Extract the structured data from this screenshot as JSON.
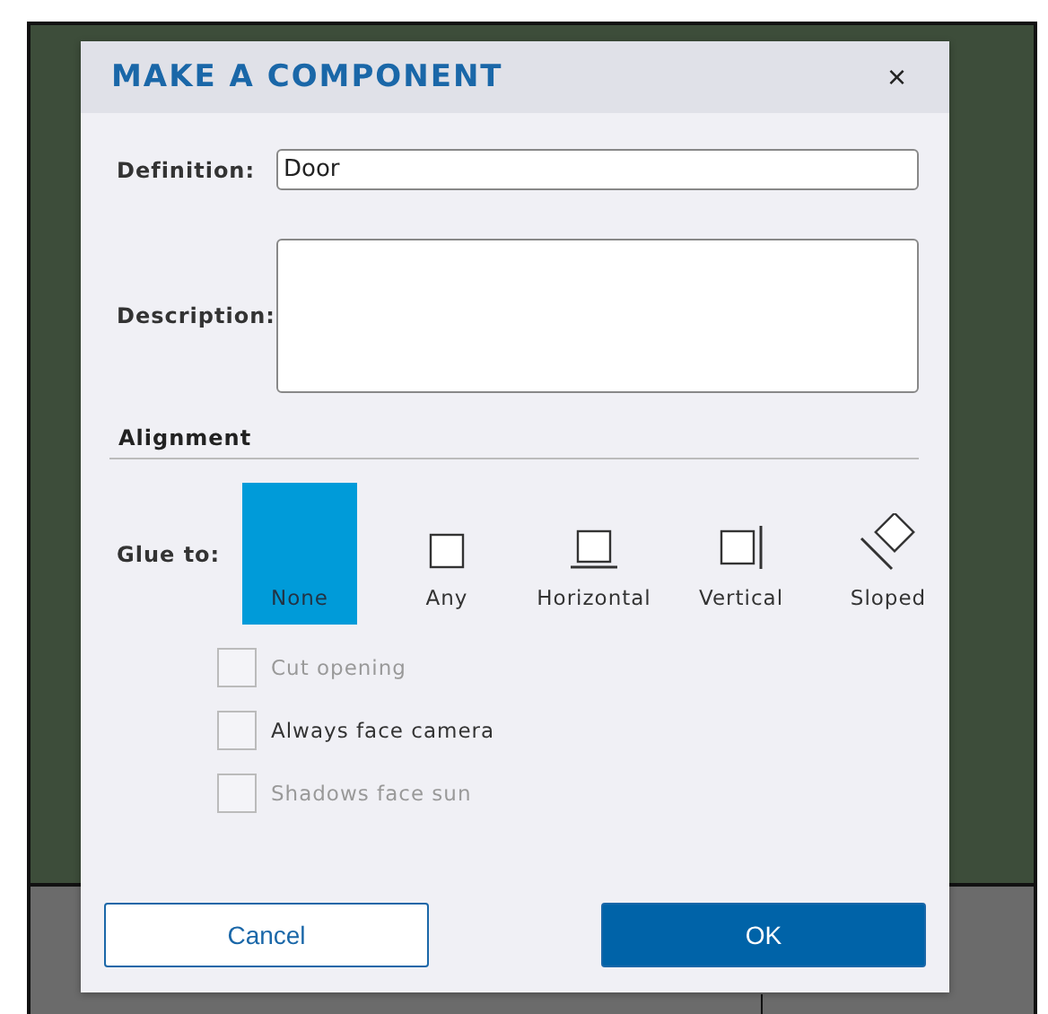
{
  "dialog": {
    "title": "MAKE A COMPONENT",
    "close": "×"
  },
  "definition": {
    "label": "Definition:",
    "value": "Door"
  },
  "description": {
    "label": "Description:"
  },
  "alignment": {
    "heading": "Alignment",
    "glue_label": "Glue to:",
    "options": [
      {
        "kind": "none",
        "label": "None",
        "selected": true
      },
      {
        "kind": "any",
        "label": "Any",
        "selected": false
      },
      {
        "kind": "horizontal",
        "label": "Horizontal",
        "selected": false
      },
      {
        "kind": "vertical",
        "label": "Vertical",
        "selected": false
      },
      {
        "kind": "sloped",
        "label": "Sloped",
        "selected": false
      }
    ]
  },
  "checkboxes": [
    {
      "label": "Cut opening",
      "checked": false,
      "disabled": true
    },
    {
      "label": "Always face camera",
      "checked": false,
      "disabled": false
    },
    {
      "label": "Shadows face sun",
      "checked": false,
      "disabled": true
    }
  ],
  "buttons": {
    "cancel": "Cancel",
    "ok": "OK"
  }
}
